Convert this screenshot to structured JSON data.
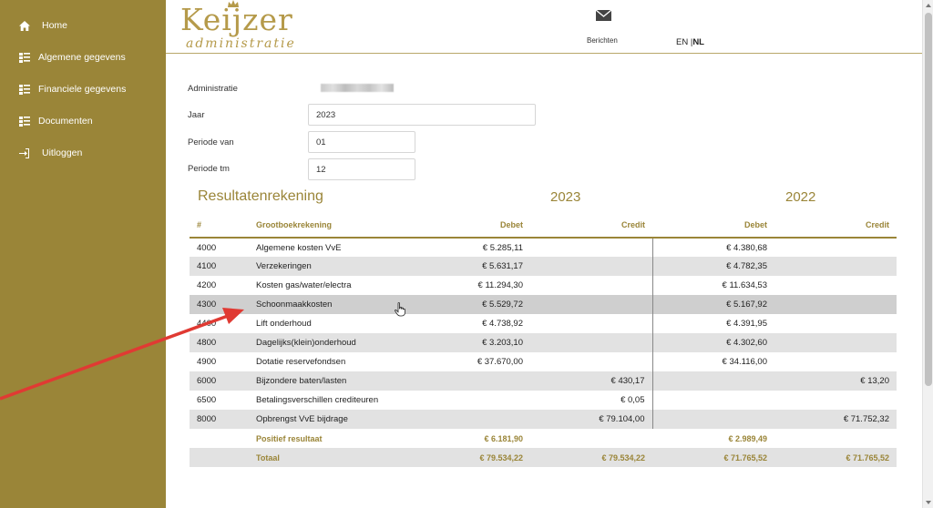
{
  "sidebar": {
    "items": [
      {
        "label": "Home",
        "icon": "home-icon"
      },
      {
        "label": "Algemene gegevens",
        "icon": "list-icon"
      },
      {
        "label": "Financiele gegevens",
        "icon": "list-icon"
      },
      {
        "label": "Documenten",
        "icon": "list-icon"
      },
      {
        "label": "Uitloggen",
        "icon": "logout-icon"
      }
    ]
  },
  "header": {
    "logo_main": "Keijzer",
    "logo_sub": "administratie",
    "messages_label": "Berichten",
    "lang_en": "EN |",
    "lang_nl": "NL"
  },
  "form": {
    "administratie_label": "Administratie",
    "jaar_label": "Jaar",
    "jaar_value": "2023",
    "periode_van_label": "Periode van",
    "periode_van_value": "01",
    "periode_tm_label": "Periode tm",
    "periode_tm_value": "12"
  },
  "report": {
    "title": "Resultatenrekening",
    "year_current": "2023",
    "year_previous": "2022",
    "headers": [
      "#",
      "Grootboekrekening",
      "Debet",
      "Credit",
      "Debet",
      "Credit"
    ],
    "rows": [
      {
        "nr": "4000",
        "name": "Algemene kosten VvE",
        "d1": "€ 5.285,11",
        "c1": "",
        "d2": "€ 4.380,68",
        "c2": ""
      },
      {
        "nr": "4100",
        "name": "Verzekeringen",
        "d1": "€ 5.631,17",
        "c1": "",
        "d2": "€ 4.782,35",
        "c2": ""
      },
      {
        "nr": "4200",
        "name": "Kosten gas/water/electra",
        "d1": "€ 11.294,30",
        "c1": "",
        "d2": "€ 11.634,53",
        "c2": ""
      },
      {
        "nr": "4300",
        "name": "Schoonmaakkosten",
        "d1": "€ 5.529,72",
        "c1": "",
        "d2": "€ 5.167,92",
        "c2": ""
      },
      {
        "nr": "4400",
        "name": "Lift onderhoud",
        "d1": "€ 4.738,92",
        "c1": "",
        "d2": "€ 4.391,95",
        "c2": ""
      },
      {
        "nr": "4800",
        "name": "Dagelijks(klein)onderhoud",
        "d1": "€ 3.203,10",
        "c1": "",
        "d2": "€ 4.302,60",
        "c2": ""
      },
      {
        "nr": "4900",
        "name": "Dotatie reservefondsen",
        "d1": "€ 37.670,00",
        "c1": "",
        "d2": "€ 34.116,00",
        "c2": ""
      },
      {
        "nr": "6000",
        "name": "Bijzondere baten/lasten",
        "d1": "",
        "c1": "€ 430,17",
        "d2": "",
        "c2": "€ 13,20"
      },
      {
        "nr": "6500",
        "name": "Betalingsverschillen crediteuren",
        "d1": "",
        "c1": "€ 0,05",
        "d2": "",
        "c2": ""
      },
      {
        "nr": "8000",
        "name": "Opbrengst VvE bijdrage",
        "d1": "",
        "c1": "€ 79.104,00",
        "d2": "",
        "c2": "€ 71.752,32"
      }
    ],
    "summary": [
      {
        "label": "Positief resultaat",
        "d1": "€ 6.181,90",
        "c1": "",
        "d2": "€ 2.989,49",
        "c2": ""
      },
      {
        "label": "Totaal",
        "d1": "€ 79.534,22",
        "c1": "€ 79.534,22",
        "d2": "€ 71.765,52",
        "c2": "€ 71.765,52"
      }
    ]
  },
  "colors": {
    "accent": "#9a8538",
    "sidebar_bg": "#9a8538",
    "row_alt": "#e2e2e2",
    "arrow": "#e03a33"
  }
}
